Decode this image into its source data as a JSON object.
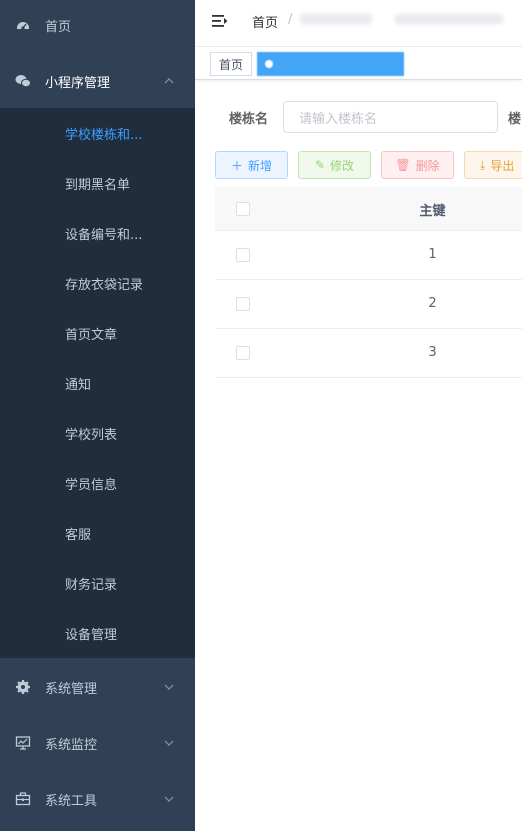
{
  "sidebar": {
    "items": [
      {
        "label": "首页",
        "icon": "dashboard-icon"
      },
      {
        "label": "小程序管理",
        "icon": "wechat-icon"
      },
      {
        "label": "系统管理",
        "icon": "gear-icon"
      },
      {
        "label": "系统监控",
        "icon": "monitor-icon"
      },
      {
        "label": "系统工具",
        "icon": "toolbox-icon"
      }
    ],
    "subitems": [
      {
        "label": "学校楼栋和..."
      },
      {
        "label": "到期黑名单"
      },
      {
        "label": "设备编号和..."
      },
      {
        "label": "存放衣袋记录"
      },
      {
        "label": "首页文章"
      },
      {
        "label": "通知"
      },
      {
        "label": "学校列表"
      },
      {
        "label": "学员信息"
      },
      {
        "label": "客服"
      },
      {
        "label": "财务记录"
      },
      {
        "label": "设备管理"
      }
    ]
  },
  "navbar": {
    "breadcrumb_home": "首页",
    "separator": "/"
  },
  "tags": {
    "home": "首页"
  },
  "search": {
    "label": "楼栋名",
    "placeholder": "请输入楼栋名",
    "label2": "楼"
  },
  "toolbar": {
    "add": "新增",
    "edit": "修改",
    "delete": "删除",
    "export": "导出"
  },
  "table": {
    "header": "主键",
    "rows": [
      "1",
      "2",
      "3"
    ]
  },
  "colors": {
    "sidebar_bg": "#304156",
    "submenu_bg": "#1f2d3d",
    "active": "#409eff"
  }
}
